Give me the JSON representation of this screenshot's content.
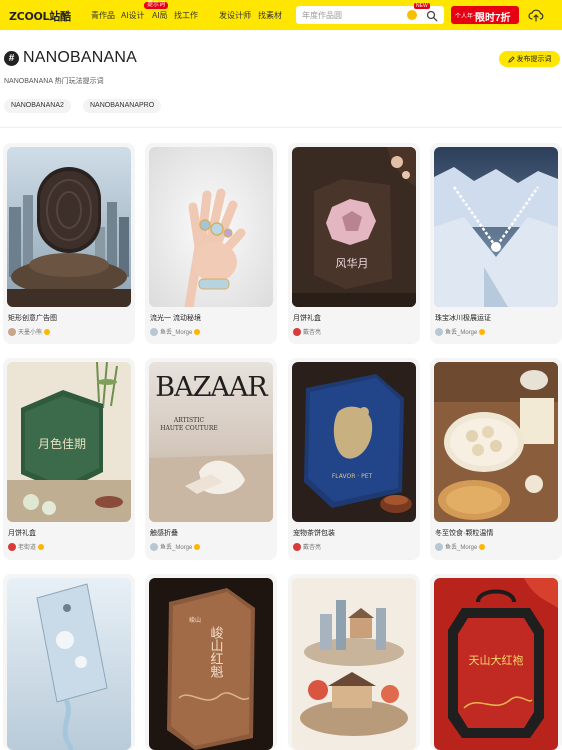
{
  "nav": {
    "logo": "ZCOOL站酷",
    "items": [
      "青作品",
      "AI设计",
      "AI局",
      "找工作",
      "发设计师",
      "找素材"
    ],
    "hot_badge": "提示词",
    "search_placeholder": "年度作品圆",
    "new_badge": "NEW",
    "promo_small": "个人年卡",
    "promo_big": "限时7折"
  },
  "header": {
    "title": "NANOBANANA",
    "publish_label": "发布提示词",
    "subtitle": "NANOBANANA 热门玩法提示词",
    "tags": [
      "NANOBANANA2",
      "NANOBANANAPRO"
    ]
  },
  "cards": [
    {
      "title": "矩形创意广告图",
      "author": "天墨小熊"
    },
    {
      "title": "流光一 流动秘境",
      "author": "鱼丢_Morge"
    },
    {
      "title": "月饼礼盒",
      "author": "戴杏亮"
    },
    {
      "title": "珠宝冰川极展运证",
      "author": "鱼丢_Morge"
    },
    {
      "title": "月饼礼盒",
      "author": "老街道"
    },
    {
      "title": "触感折叠",
      "author": "鱼丢_Morge"
    },
    {
      "title": "宠物茶饼包装",
      "author": "戴杏亮"
    },
    {
      "title": "冬至饺食·颗粒温情",
      "author": "鱼丢_Morge"
    },
    {
      "title": "",
      "author": ""
    },
    {
      "title": "",
      "author": ""
    },
    {
      "title": "",
      "author": ""
    },
    {
      "title": "",
      "author": ""
    }
  ],
  "image_text": {
    "c3": "风华月",
    "c5": "月色佳期",
    "c6_mag": "BAZAAR",
    "c6_line1": "ARTISTIC",
    "c6_line2": "HAUTE COUTURE",
    "c7": "FLAVOR · PET",
    "c10_main": "峻山红魁",
    "c10_small": "峻山",
    "c12": "天山大红袍"
  },
  "colors": {
    "accent": "#ffe600",
    "promo_red": "#e60012",
    "verified_badge": "#ffb400"
  }
}
